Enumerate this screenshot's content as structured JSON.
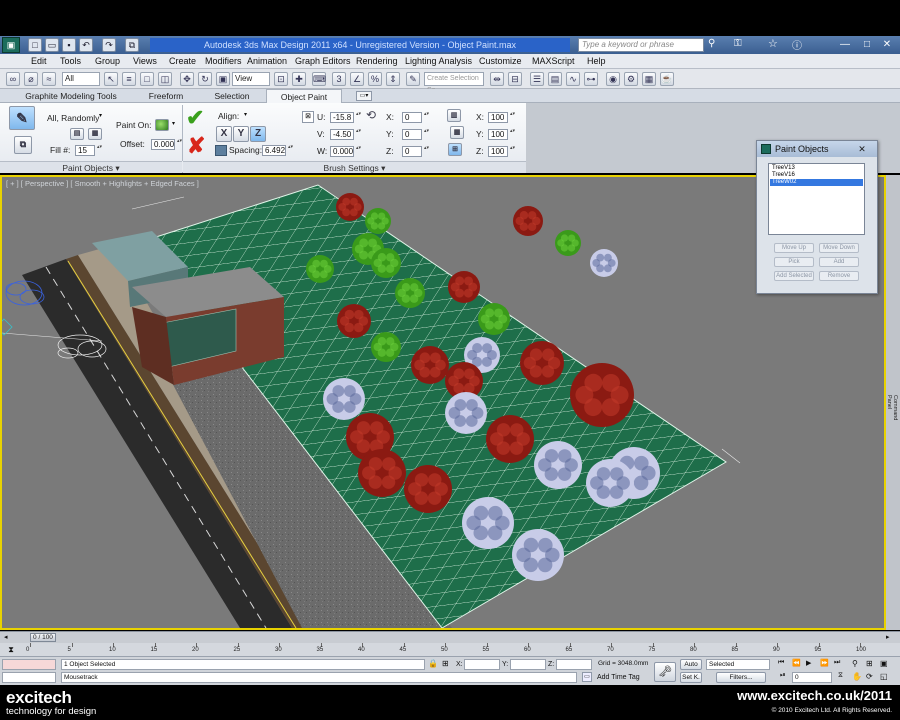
{
  "window": {
    "title": "Autodesk 3ds Max Design 2011 x64    -    Unregistered Version    -    Object Paint.max",
    "search_placeholder": "Type a keyword or phrase",
    "quick_access_icons": [
      "new-icon",
      "open-icon",
      "save-icon",
      "undo-icon",
      "redo-icon"
    ],
    "window_controls": [
      "minimize-icon",
      "maximize-icon",
      "close-icon"
    ]
  },
  "menu": {
    "items": [
      "Edit",
      "Tools",
      "Group",
      "Views",
      "Create",
      "Modifiers",
      "Animation",
      "Graph Editors",
      "Rendering",
      "Lighting Analysis",
      "Customize",
      "MAXScript",
      "Help"
    ]
  },
  "toolbar": {
    "selection_filter": "All",
    "ref_coord": "View",
    "named_selection_placeholder": "Create Selection Se"
  },
  "ribbon_tabs": {
    "items": [
      "Graphite Modeling Tools",
      "Freeform",
      "Selection",
      "Object Paint"
    ],
    "active": "Object Paint"
  },
  "paint_objects_panel": {
    "mode_label": "All, Randomly",
    "fill_label": "Fill #:",
    "fill_value": "15",
    "paint_on_label": "Paint On:",
    "offset_label": "Offset:",
    "offset_value": "0.000",
    "footer": "Paint Objects"
  },
  "brush_settings_panel": {
    "align_label": "Align:",
    "axes": [
      "X",
      "Y",
      "Z"
    ],
    "active_axis": "Z",
    "spacing_label": "Spacing:",
    "spacing_value": "6.492",
    "u_label": "U:",
    "u_value": "-15.8",
    "v_label": "V:",
    "v_value": "-4.50",
    "w_label": "W:",
    "w_value": "0.000",
    "rot_x_label": "X:",
    "rot_x_value": "0",
    "rot_y_label": "Y:",
    "rot_y_value": "0",
    "rot_z_label": "Z:",
    "rot_z_value": "0",
    "scale_x_label": "X:",
    "scale_x_value": "100",
    "scale_y_label": "Y:",
    "scale_y_value": "100",
    "scale_z_label": "Z:",
    "scale_z_value": "100",
    "footer": "Brush Settings"
  },
  "viewport": {
    "label": "[ + ] [ Perspective ] [ Smooth + Highlights + Edged Faces ]"
  },
  "command_panel": {
    "label": "Command Panel"
  },
  "paint_dialog": {
    "title": "Paint Objects",
    "list_items": [
      "TreeV13",
      "TreeV16",
      "TreeW02"
    ],
    "selected_index": 2,
    "buttons": [
      "Move Up",
      "Move Down",
      "Pick",
      "Add",
      "Add Selected",
      "Remove"
    ]
  },
  "timeline": {
    "thumb_label": "0 / 100",
    "ticks": [
      "0",
      "5",
      "10",
      "15",
      "20",
      "25",
      "30",
      "35",
      "40",
      "45",
      "50",
      "55",
      "60",
      "65",
      "70",
      "75",
      "80",
      "85",
      "90",
      "95",
      "100"
    ]
  },
  "status": {
    "selection": "1 Object Selected",
    "prompt": "Mousetrack",
    "x_label": "X:",
    "y_label": "Y:",
    "z_label": "Z:",
    "grid": "Grid = 3048.0mm",
    "add_time_tag": "Add Time Tag",
    "auto_btn": "Auto",
    "set_key_btn": "Set K.",
    "key_filter": "Selected",
    "filters_btn": "Filters...",
    "frame_value": "0"
  },
  "branding": {
    "left_title": "excitech",
    "left_sub": "technology for design",
    "right_url": "www.excitech.co.uk/2011",
    "right_copy": "© 2010 Excitech Ltd. All Rights Reserved."
  },
  "colors": {
    "grass": "#1e6e4a",
    "grid_line": "#ffffff",
    "tree_red": "#8b1a12",
    "tree_green": "#3a9a1a",
    "tree_white": "#c8cce8",
    "road": "#2a2a2a",
    "viewport_bg": "#7c7c7c",
    "active_border": "#e8d200",
    "title_bar": "#2a63c8"
  }
}
